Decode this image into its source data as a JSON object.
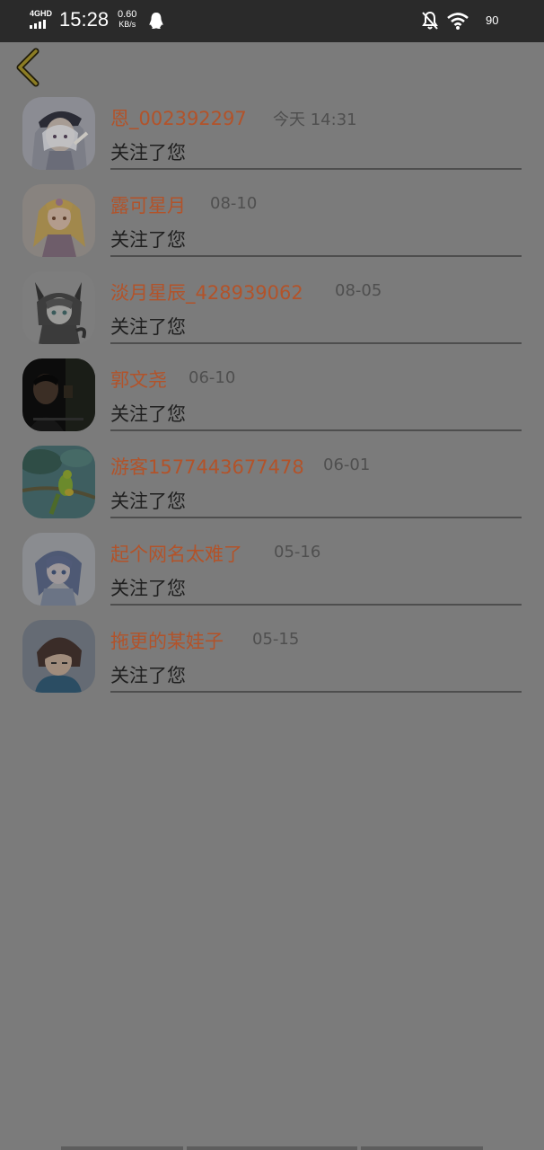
{
  "status_bar": {
    "network_type": "4GHD",
    "time": "15:28",
    "speed_value": "0.60",
    "speed_unit": "KB/s",
    "battery": "90",
    "icons": [
      "signal-icon",
      "qq-notification-icon",
      "mute-bell-icon",
      "wifi-icon",
      "battery-icon"
    ]
  },
  "nav": {
    "back_icon": "chevron-left-icon",
    "back_color": "#c6b23a"
  },
  "colors": {
    "name": "#b2532a",
    "overlay_background": "#7b7b7b",
    "status_bar": "#2a2a2a"
  },
  "followers": [
    {
      "name": "恩_002392297",
      "time": "今天 14:31",
      "action": "关注了您",
      "avatar": "anime-avatar-white-hair"
    },
    {
      "name": "露可星月",
      "time": "08-10",
      "action": "关注了您",
      "avatar": "anime-avatar-blonde-girl"
    },
    {
      "name": "淡月星辰_428939062",
      "time": "08-05",
      "action": "关注了您",
      "avatar": "anime-avatar-cat-ears"
    },
    {
      "name": "郭文尧",
      "time": "06-10",
      "action": "关注了您",
      "avatar": "photo-avatar-man-dark"
    },
    {
      "name": "游客1577443677478",
      "time": "06-01",
      "action": "关注了您",
      "avatar": "photo-avatar-parrot"
    },
    {
      "name": "起个网名太难了",
      "time": "05-16",
      "action": "关注了您",
      "avatar": "anime-avatar-blue-hair"
    },
    {
      "name": "拖更的某娃子",
      "time": "05-15",
      "action": "关注了您",
      "avatar": "anime-avatar-brown-hair-boy"
    }
  ]
}
